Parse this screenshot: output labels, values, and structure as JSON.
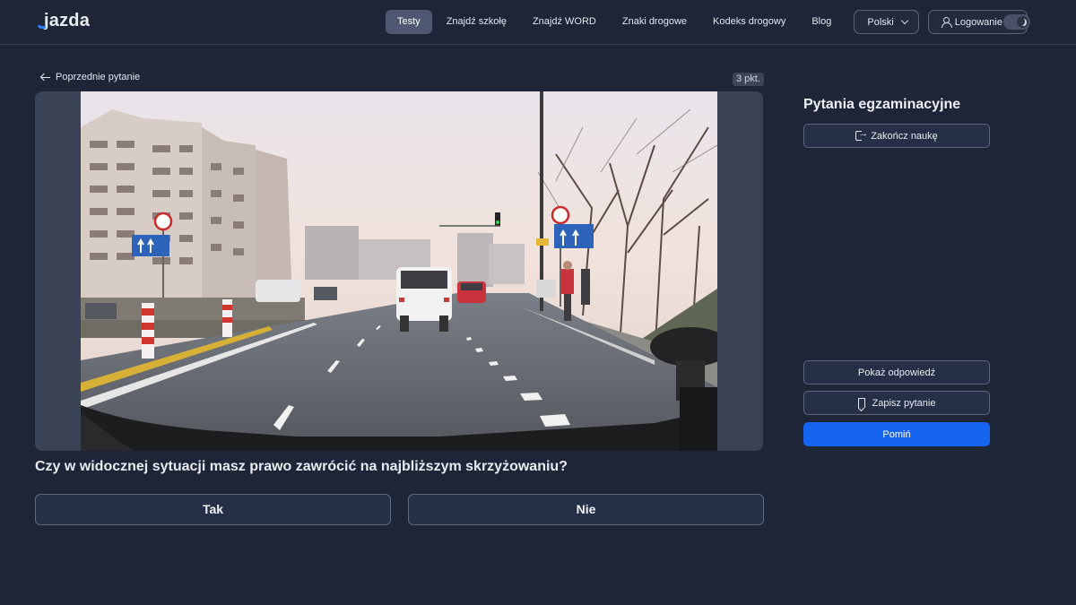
{
  "header": {
    "logo": "jazda",
    "nav": [
      "Testy",
      "Znajdź szkołę",
      "Znajdź WORD",
      "Znaki drogowe",
      "Kodeks drogowy",
      "Blog"
    ],
    "active_nav": "Testy",
    "language": "Polski",
    "login": "Logowanie",
    "theme_toggle_icon": "moon-icon"
  },
  "question_area": {
    "prev_label": "Poprzednie pytanie",
    "points": "3 pkt.",
    "question": "Czy w widocznej sytuacji masz prawo zawrócić na najbliższym skrzyżowaniu?",
    "answers": [
      "Tak",
      "Nie"
    ]
  },
  "panel": {
    "title": "Pytania egzaminacyjne",
    "finish_label": "Zakończ naukę",
    "show_answer_label": "Pokaż odpowiedź",
    "save_label": "Zapisz pytanie",
    "skip_label": "Pomiń"
  },
  "colors": {
    "background": "#1e2537",
    "primary": "#1565f0",
    "active_nav": "#4e5872"
  }
}
